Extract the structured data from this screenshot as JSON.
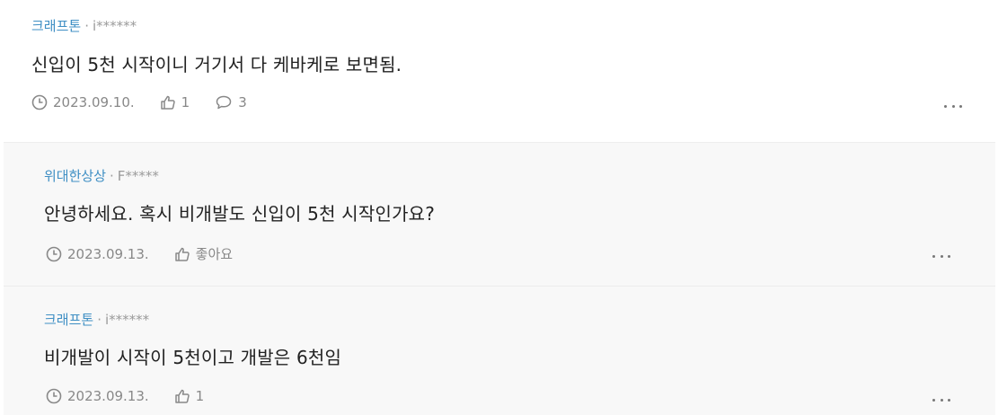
{
  "comments": [
    {
      "author": "크래프톤",
      "separator": "·",
      "user_id": "i******",
      "text": "신입이 5천 시작이니 거기서 다 케바케로 보면됨.",
      "date": "2023.09.10.",
      "likes": "1",
      "replies": "3"
    },
    {
      "author": "위대한상상",
      "separator": "·",
      "user_id": "F*****",
      "text": "안녕하세요. 혹시 비개발도 신입이 5천 시작인가요?",
      "date": "2023.09.13.",
      "like_label": "좋아요"
    },
    {
      "author": "크래프톤",
      "separator": "·",
      "user_id": "i******",
      "text": "비개발이 시작이 5천이고 개발은 6천임",
      "date": "2023.09.13.",
      "likes": "1"
    }
  ],
  "icons": {
    "date": "clock-icon",
    "like": "thumbs-up-icon",
    "reply": "speech-bubble-icon",
    "more": "more-dots-icon"
  },
  "colors": {
    "author": "#3f8fc4",
    "reply_background": "#f8f8f8"
  }
}
